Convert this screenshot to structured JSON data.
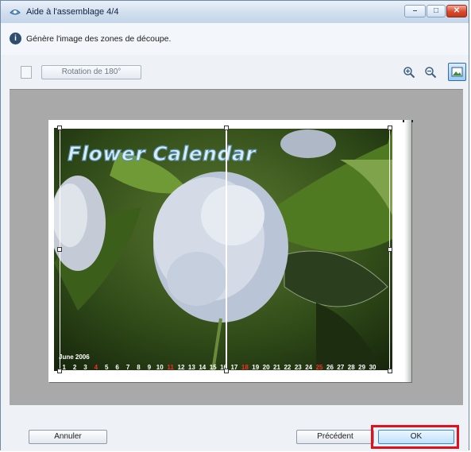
{
  "window": {
    "title": "Aide à l'assemblage 4/4"
  },
  "header": {
    "instruction": "Génère l'image des zones de découpe."
  },
  "toolbar": {
    "rotate_label": "Rotation de 180°",
    "zoom_in_icon": "zoom-in-icon",
    "zoom_out_icon": "zoom-out-icon",
    "fit_icon": "fit-to-window-icon"
  },
  "preview": {
    "image_title": "Flower Calendar",
    "calendar_month": "June 2006",
    "calendar_days": [
      "1",
      "2",
      "3",
      "4",
      "5",
      "6",
      "7",
      "8",
      "9",
      "10",
      "11",
      "12",
      "13",
      "14",
      "15",
      "16",
      "17",
      "18",
      "19",
      "20",
      "21",
      "22",
      "23",
      "24",
      "25",
      "26",
      "27",
      "28",
      "29",
      "30"
    ],
    "red_days": [
      "4",
      "11",
      "18",
      "25"
    ]
  },
  "footer": {
    "cancel_label": "Annuler",
    "previous_label": "Précédent",
    "ok_label": "OK"
  },
  "colors": {
    "highlight": "#e2101b",
    "title_bar": "#cfdded",
    "preview_bg": "#a9a9a9"
  }
}
